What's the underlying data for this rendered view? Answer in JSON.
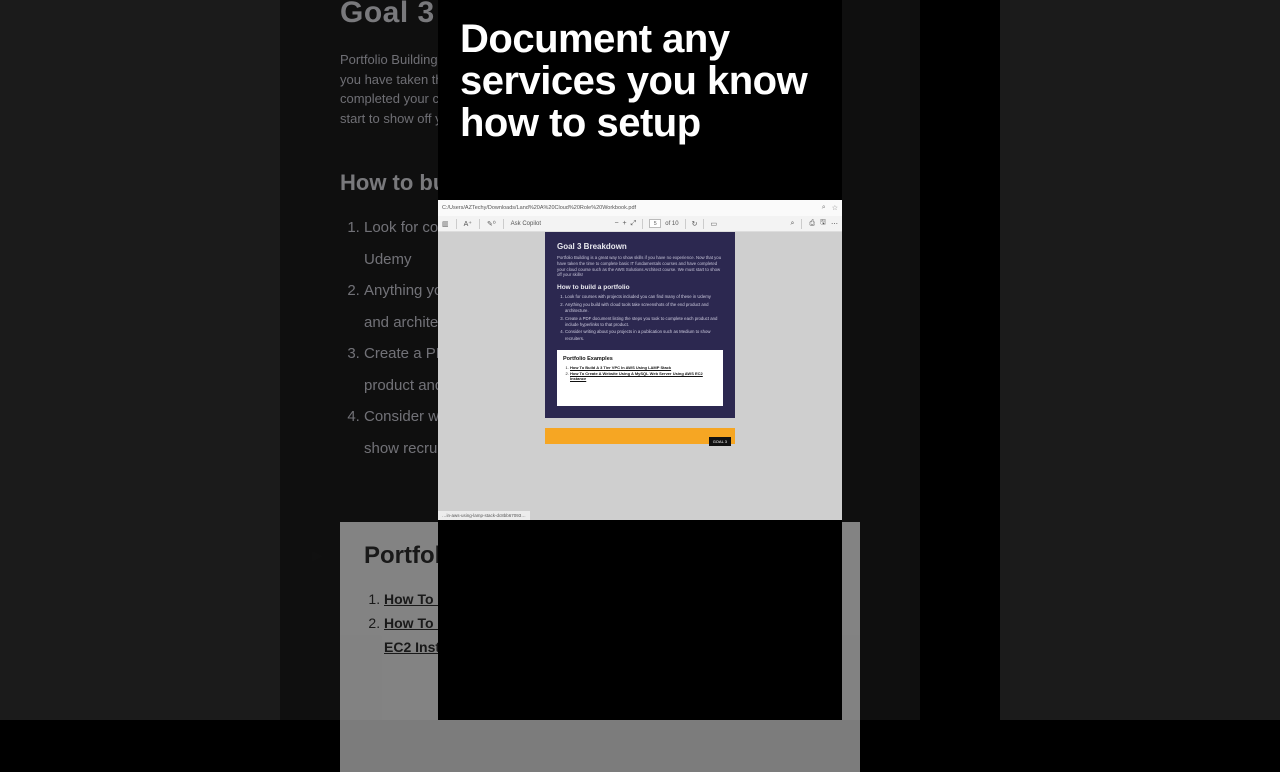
{
  "overlay": {
    "headline": "Document any services you know how to setup"
  },
  "bg_doc": {
    "title": "Goal 3 Breakdown",
    "intro": "Portfolio Building is a great way to show skills if you have no experience. Now that you have taken the time to complete basic IT fundamentals courses and have completed your cloud course such as the AWS Solutions Architect course. We must start to show off your skills!",
    "subtitle": "How to build a portfolio",
    "items": [
      "Look for courses with projects included you can find many of these in Udemy",
      "Anything you build with cloud tools take screenshots of the end product and architecture.",
      "Create a PDF document listing the steps you took to complete each product and include hyperlinks to that product.",
      "Consider writing about you projects in a publication such as Medium to show recruiters."
    ],
    "portfolio_title": "Portfolio Examples",
    "portfolio_items": [
      "How To Build A 3 Tier VPC In AWS Using LAMP Stack",
      "How To Create A Website Using A MySQL Web Server Using AWS EC2 Instance"
    ]
  },
  "pdf": {
    "address": "C:/Users/AZTechy/Downloads/Land%20A%20Cloud%20Role%20Workbook.pdf",
    "toolbar": {
      "ask_copilot": "Ask Copilot",
      "page_current": "5",
      "page_total": "of 10",
      "read_aloud": "A⁰",
      "text_size": "A⁺"
    },
    "page": {
      "h1": "Goal 3 Breakdown",
      "para": "Portfolio Building is a great way to show skills if you have no experience. Now that you have taken the time to complete basic IT fundamentals courses and have completed your cloud course such as the AWS Solutions Architect course. We must start to show off your skills!",
      "h2": "How to build a portfolio",
      "list": [
        "Look for courses with projects included you can find many of these in Udemy",
        "Anything you build with cloud tools take screenshots of the end product and architecture.",
        "Create a PDF document listing the steps you took to complete each product and include hyperlinks to that product.",
        "Consider writing about you projects in a publication such as Medium to show recruiters."
      ],
      "box_title": "Portfolio Examples",
      "box_items": [
        "How To Build A 3 Tier VPC In AWS Using LAMP Stack",
        "How To Create A Website Using A MySQL Web Server Using AWS EC2 Instance"
      ],
      "gold_tag": "GOAL 3"
    },
    "status": "…in-aws-using-lamp-stack-dc8bb67093…"
  }
}
